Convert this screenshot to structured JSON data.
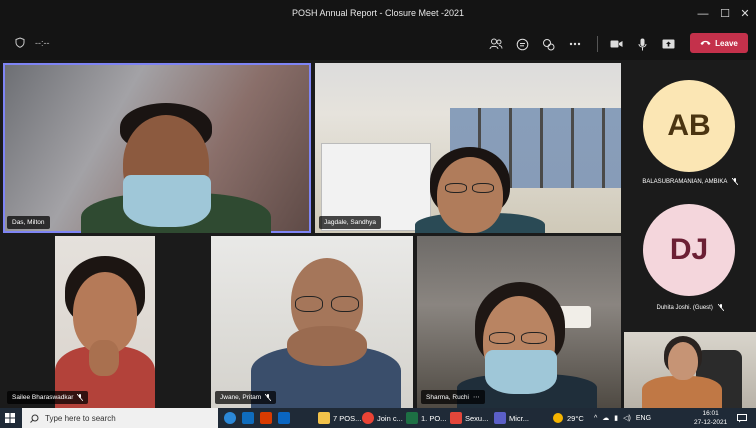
{
  "window": {
    "title": "POSH Annual Report - Closure Meet -2021",
    "controls": [
      "—",
      "☐",
      "✕"
    ]
  },
  "toolbar": {
    "timer": "--:--",
    "leave_label": "Leave",
    "leave_color": "#c4314b"
  },
  "participants": [
    {
      "name": "Das, Milton",
      "active": true
    },
    {
      "name": "Jagdale, Sandhya",
      "active": false
    },
    {
      "name": "Sailee Bharaswadkar",
      "active": false
    },
    {
      "name": "Jwane, Pritam",
      "active": false
    },
    {
      "name": "Sharma, Ruchi",
      "active": false
    }
  ],
  "side_panel": [
    {
      "initials": "AB",
      "name": "BALASUBRAMANIAN, AMBIKA",
      "bg": "#fbe6b4",
      "fg": "#4a3411"
    },
    {
      "initials": "DJ",
      "name": "Duhita Joshi. (Guest)",
      "bg": "#f4d6dc",
      "fg": "#6b1f34"
    }
  ],
  "taskbar": {
    "search_placeholder": "Type here to search",
    "apps": [
      "7 POS...",
      "Join c...",
      "1. PO...",
      "Sexu...",
      "Micr..."
    ],
    "weather": "29°C",
    "lang": "ENG",
    "time": "16:01",
    "date": "27-12-2021"
  }
}
